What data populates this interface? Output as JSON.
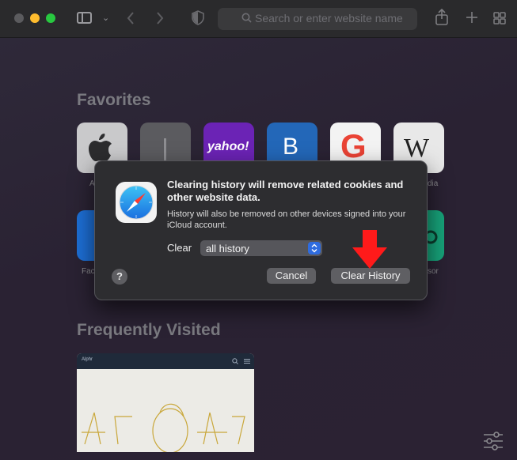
{
  "toolbar": {
    "address_placeholder": "Search or enter website name",
    "icons": [
      "sidebar-icon",
      "chevron-down-icon",
      "back-icon",
      "forward-icon",
      "shield-icon",
      "search-icon",
      "share-icon",
      "new-tab-icon",
      "tab-overview-icon"
    ]
  },
  "favorites": {
    "title": "Favorites",
    "tiles": [
      {
        "name": "apple",
        "glyph": "",
        "label": "A",
        "bg": "#c9c9cb"
      },
      {
        "name": "blank",
        "glyph": "I",
        "label": "",
        "bg": "#5b5b5f"
      },
      {
        "name": "yahoo",
        "glyph": "yahoo!",
        "label": "",
        "bg": "#6b23b5"
      },
      {
        "name": "bing",
        "glyph": "B",
        "label": "",
        "bg": "#2367b8"
      },
      {
        "name": "google",
        "glyph": "G",
        "label": "",
        "bg": "#f3f3f3"
      },
      {
        "name": "wikipedia",
        "glyph": "W",
        "label": "dia",
        "bg": "#e8e8e8"
      }
    ],
    "row2": [
      {
        "name": "facebook",
        "glyph": "",
        "label": "Fac",
        "bg": "#1d6fd6"
      },
      {
        "name": "tripadvisor",
        "glyph": "",
        "label": "sor",
        "bg": "#17a37a"
      }
    ]
  },
  "frequently_visited": {
    "title": "Frequently Visited",
    "card_brand": "Alphr"
  },
  "dialog": {
    "title": "Clearing history will remove related cookies and other website data.",
    "message": "History will also be removed on other devices signed into your iCloud account.",
    "clear_label": "Clear",
    "select_value": "all history",
    "cancel_label": "Cancel",
    "confirm_label": "Clear History",
    "help_label": "?"
  },
  "colors": {
    "accent": "#2f6cdf",
    "annotation": "#ff1a1a"
  }
}
